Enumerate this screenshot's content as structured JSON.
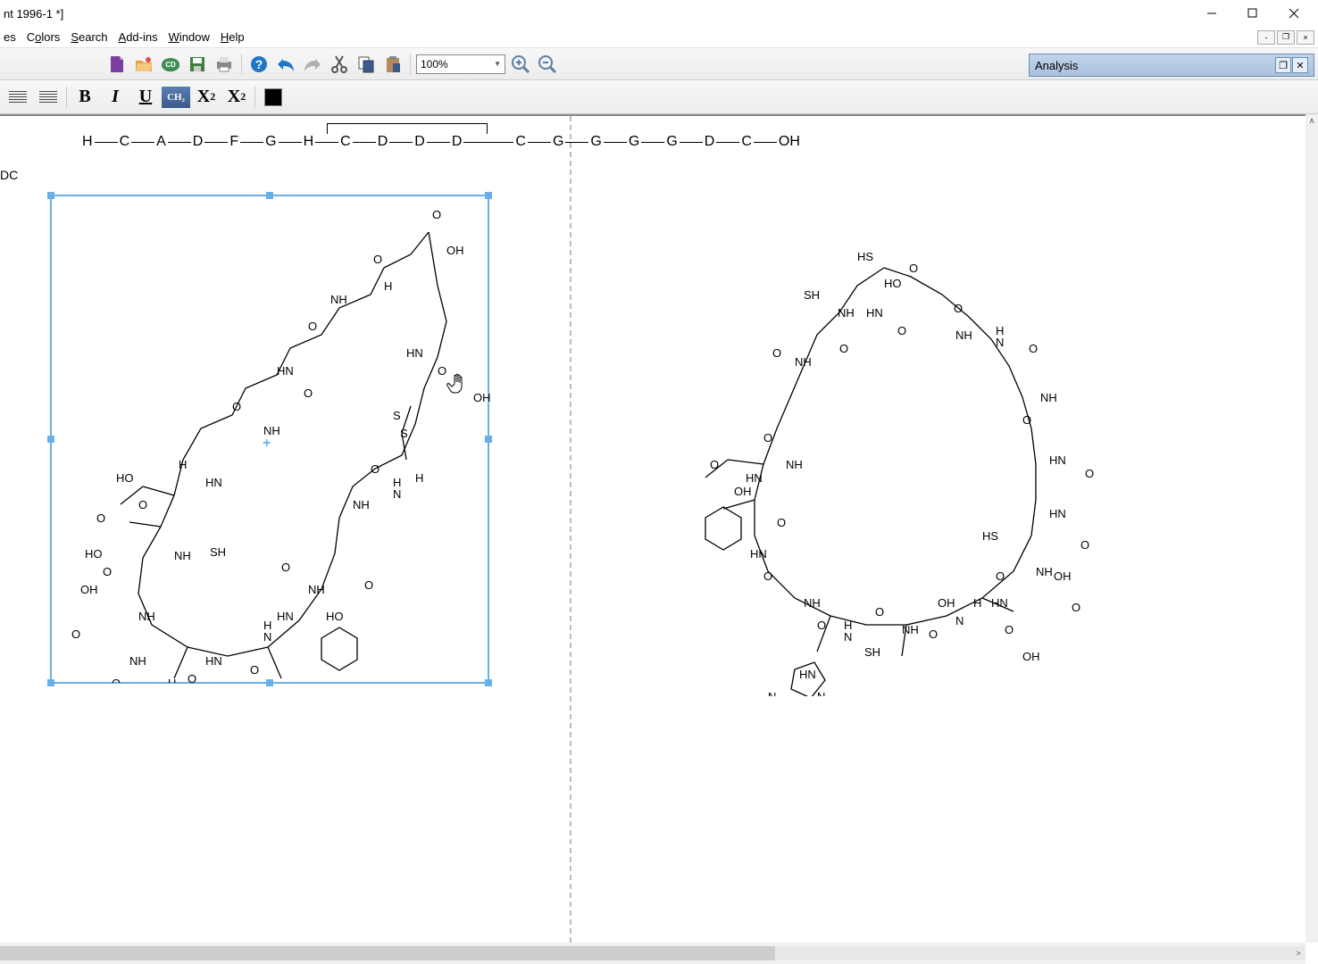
{
  "window": {
    "title": "nt 1996-1 *]"
  },
  "menu": {
    "items": [
      "es",
      "Colors",
      "Search",
      "Add-ins",
      "Window",
      "Help"
    ],
    "underline_map": [
      "",
      "o",
      "S",
      "A",
      "W",
      "H"
    ]
  },
  "toolbar": {
    "zoom_value": "100%"
  },
  "format_bar": {
    "bold": "B",
    "italic": "I",
    "underline": "U",
    "ch2": "CH₂",
    "sub": "X₂",
    "sup": "X²"
  },
  "analysis": {
    "title": "Analysis"
  },
  "canvas": {
    "dc_label": "DC",
    "sequence": [
      "H",
      "C",
      "A",
      "D",
      "F",
      "G",
      "H",
      "C",
      "D",
      "D",
      "D",
      "C",
      "G",
      "G",
      "G",
      "G",
      "D",
      "C",
      "OH"
    ]
  },
  "structures": {
    "left_caption": "",
    "right_caption": ""
  }
}
